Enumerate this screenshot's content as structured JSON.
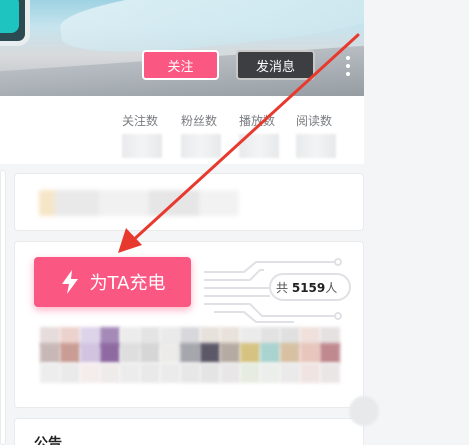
{
  "header": {
    "follow_label": "关注",
    "message_label": "发消息",
    "more_icon": "more-vertical-icon"
  },
  "stats": [
    {
      "label": "关注数"
    },
    {
      "label": "粉丝数"
    },
    {
      "label": "播放数"
    },
    {
      "label": "阅读数"
    }
  ],
  "charge": {
    "button_label": "为TA充电",
    "icon": "lightning-icon",
    "total_prefix": "共",
    "total_count": "5159",
    "total_suffix": "人"
  },
  "notice": {
    "title": "公告"
  },
  "colors": {
    "accent": "#fb5783",
    "arrow": "#e8392f",
    "dark_button": "#3c3e42"
  }
}
